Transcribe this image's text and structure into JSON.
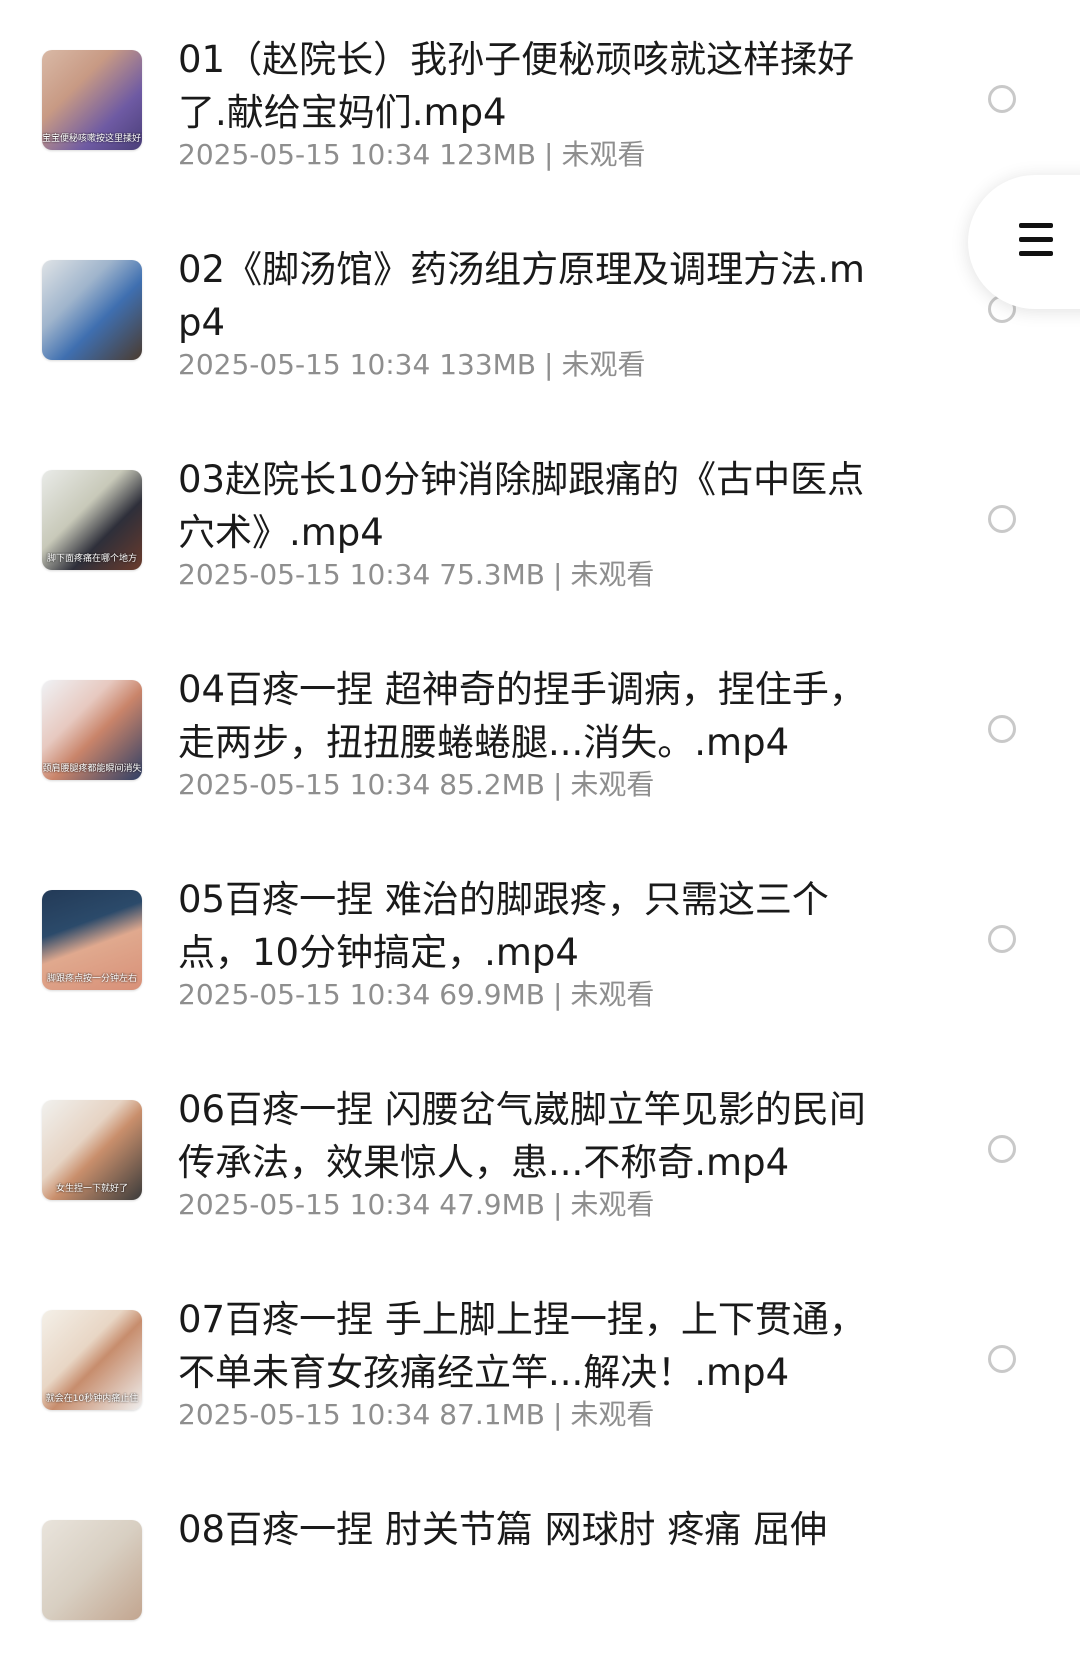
{
  "files": [
    {
      "title": "01（赵院长）我孙子便秘顽咳就这样揉好了.献给宝妈们.mp4",
      "date": "2025-05-15 10:34",
      "size": "123MB",
      "status": "未观看",
      "thumb_caption": "宝宝便秘咳嗽按这里揉好了"
    },
    {
      "title": "02《脚汤馆》药汤组方原理及调理方法.mp4",
      "date": "2025-05-15 10:34",
      "size": "133MB",
      "status": "未观看",
      "thumb_caption": ""
    },
    {
      "title": "03赵院长10分钟消除脚跟痛的《古中医点穴术》.mp4",
      "date": "2025-05-15 10:34",
      "size": "75.3MB",
      "status": "未观看",
      "thumb_caption": "脚下面疼痛在哪个地方"
    },
    {
      "title": "04百疼一捏 超神奇的捏手调病，捏住手，走两步，扭扭腰蜷蜷腿...消失。.mp4",
      "date": "2025-05-15 10:34",
      "size": "85.2MB",
      "status": "未观看",
      "thumb_caption": "颈肩腰腿疼都能瞬间消失"
    },
    {
      "title": "05百疼一捏 难治的脚跟疼，只需这三个点，10分钟搞定，.mp4",
      "date": "2025-05-15 10:34",
      "size": "69.9MB",
      "status": "未观看",
      "thumb_caption": "脚跟疼点按一分钟左右"
    },
    {
      "title": "06百疼一捏 闪腰岔气崴脚立竿见影的民间传承法，效果惊人，患...不称奇.mp4",
      "date": "2025-05-15 10:34",
      "size": "47.9MB",
      "status": "未观看",
      "thumb_caption": "女生捏一下就好了"
    },
    {
      "title": "07百疼一捏 手上脚上捏一捏，上下贯通，不单未育女孩痛经立竿...解决！.mp4",
      "date": "2025-05-15 10:34",
      "size": "87.1MB",
      "status": "未观看",
      "thumb_caption": "就会在10秒钟内痛止住"
    },
    {
      "title": "08百疼一捏 肘关节篇 网球肘 疼痛 屈伸",
      "date": "",
      "size": "",
      "status": "",
      "thumb_caption": ""
    }
  ],
  "menu_icon": "hamburger-menu-icon"
}
